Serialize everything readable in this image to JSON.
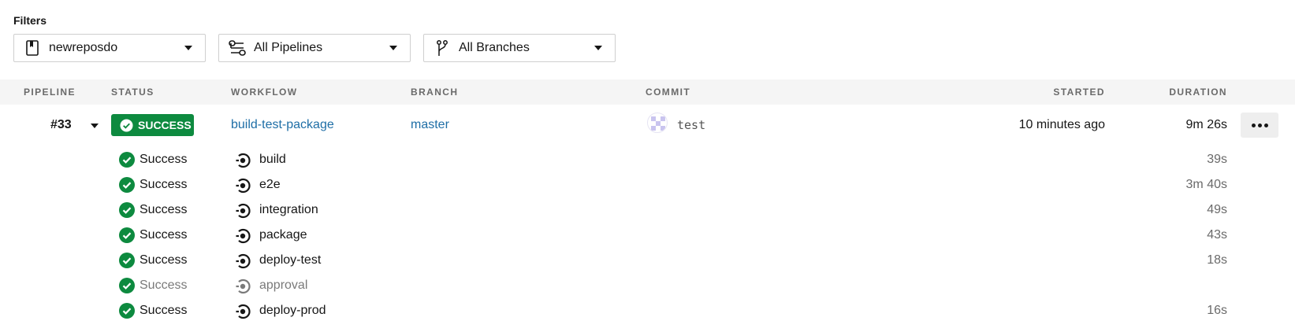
{
  "filters": {
    "label": "Filters",
    "project": {
      "value": "newreposdo",
      "icon": "bookmark-icon"
    },
    "pipelines": {
      "value": "All Pipelines",
      "icon": "pipeline-icon"
    },
    "branches": {
      "value": "All Branches",
      "icon": "branch-icon"
    }
  },
  "table": {
    "headers": {
      "pipeline": "Pipeline",
      "status": "Status",
      "workflow": "Workflow",
      "branch": "Branch",
      "commit": "Commit",
      "started": "Started",
      "duration": "Duration"
    }
  },
  "pipeline": {
    "number": "#33",
    "status": "SUCCESS",
    "workflow": "build-test-package",
    "branch": "master",
    "commit_message": "test",
    "started": "10 minutes ago",
    "duration": "9m 26s"
  },
  "jobs": [
    {
      "status": "Success",
      "name": "build",
      "duration": "39s"
    },
    {
      "status": "Success",
      "name": "e2e",
      "duration": "3m 40s"
    },
    {
      "status": "Success",
      "name": "integration",
      "duration": "49s"
    },
    {
      "status": "Success",
      "name": "package",
      "duration": "43s"
    },
    {
      "status": "Success",
      "name": "deploy-test",
      "duration": "18s"
    },
    {
      "status": "Success",
      "name": "approval",
      "duration": ""
    },
    {
      "status": "Success",
      "name": "deploy-prod",
      "duration": "16s"
    }
  ],
  "colors": {
    "success": "#0d8a3f",
    "link": "#1e6ea6",
    "header_bg": "#f5f5f5"
  }
}
